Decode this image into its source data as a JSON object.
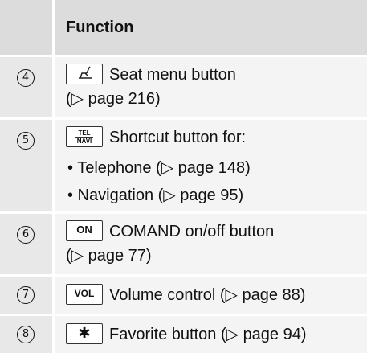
{
  "header": {
    "title": "Function"
  },
  "rows": [
    {
      "number": "4",
      "key_icon": "seat-icon",
      "text": "Seat menu button",
      "page_ref": "(▷ page 216)"
    },
    {
      "number": "5",
      "key_label_top": "TEL",
      "key_label_bottom": "NAVI",
      "text": "Shortcut button for:",
      "bullets": [
        "• Telephone (▷ page 148)",
        "• Navigation (▷ page 95)"
      ]
    },
    {
      "number": "6",
      "key_label": "ON",
      "text": "COMAND on/off button",
      "page_ref": "(▷ page 77)"
    },
    {
      "number": "7",
      "key_label": "VOL",
      "text": "Volume control (▷ page 88)"
    },
    {
      "number": "8",
      "key_label": "✱",
      "text": "Favorite button (▷ page 94)"
    }
  ]
}
